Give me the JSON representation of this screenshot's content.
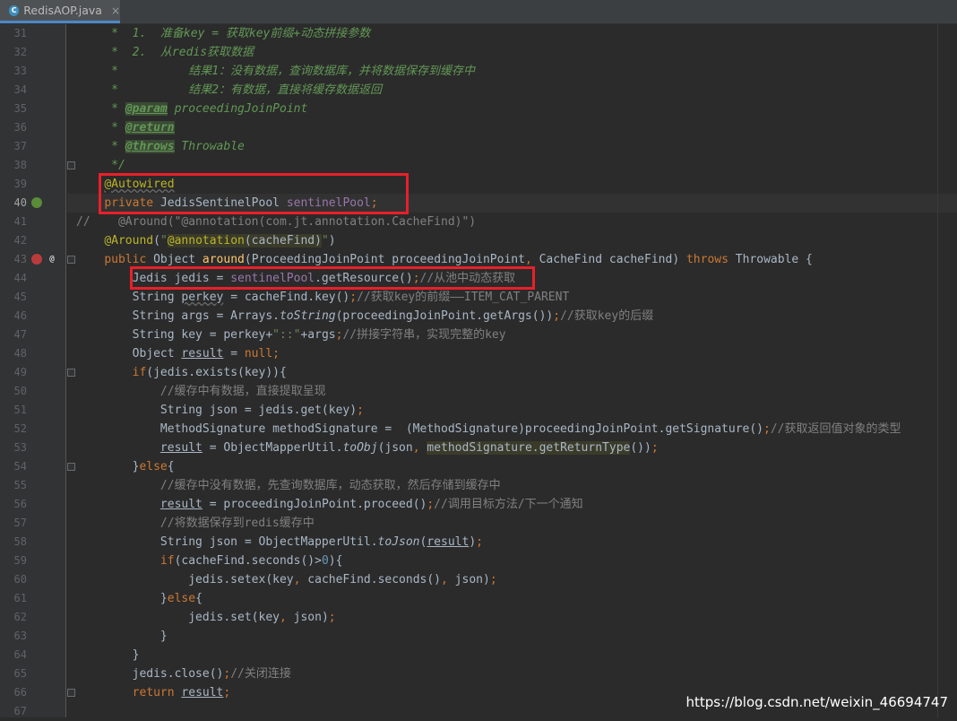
{
  "tab": {
    "filename": "RedisAOP.java",
    "icon": "java-class-icon",
    "close": "×",
    "file_badge": "C"
  },
  "lines": [
    {
      "n": "31",
      "seg": [
        [
          "",
          "    "
        ],
        [
          "cm",
          " *  1.  准备key = 获取key前缀+动态拼接参数"
        ]
      ]
    },
    {
      "n": "32",
      "seg": [
        [
          "",
          "    "
        ],
        [
          "cm",
          " *  2.  从redis获取数据"
        ]
      ]
    },
    {
      "n": "33",
      "seg": [
        [
          "",
          "    "
        ],
        [
          "cm",
          " *          结果1：没有数据，查询数据库，并将数据保存到缓存中"
        ]
      ]
    },
    {
      "n": "34",
      "seg": [
        [
          "",
          "    "
        ],
        [
          "cm",
          " *          结果2：有数据，直接将缓存数据返回"
        ]
      ]
    },
    {
      "n": "35",
      "seg": [
        [
          "",
          "    "
        ],
        [
          "cm",
          " * "
        ],
        [
          "tag",
          "@param"
        ],
        [
          "cm",
          " proceedingJoinPoint"
        ]
      ]
    },
    {
      "n": "36",
      "seg": [
        [
          "",
          "    "
        ],
        [
          "cm",
          " * "
        ],
        [
          "tag",
          "@return"
        ]
      ]
    },
    {
      "n": "37",
      "seg": [
        [
          "",
          "    "
        ],
        [
          "cm",
          " * "
        ],
        [
          "tag",
          "@throws"
        ],
        [
          "cm",
          " Throwable"
        ]
      ]
    },
    {
      "n": "38",
      "seg": [
        [
          "",
          "    "
        ],
        [
          "cm",
          " */"
        ]
      ]
    },
    {
      "n": "39",
      "seg": [
        [
          "",
          "    "
        ],
        [
          "an wv",
          "@Autowired"
        ]
      ]
    },
    {
      "n": "40",
      "seg": [
        [
          "",
          "    "
        ],
        [
          "k",
          "private "
        ],
        [
          "",
          "JedisSentinelPool "
        ],
        [
          "fd",
          "sentinelPool"
        ],
        [
          "k",
          ";"
        ]
      ]
    },
    {
      "n": "41",
      "seg": [
        [
          "lc",
          "//    @Around(\"@annotation(com.jt.annotation.CacheFind)\")"
        ]
      ]
    },
    {
      "n": "42",
      "seg": [
        [
          "",
          "    "
        ],
        [
          "an",
          "@Around"
        ],
        [
          "",
          "("
        ],
        [
          "s",
          "\""
        ],
        [
          "hl an",
          "@annotation"
        ],
        [
          "hl",
          "(cacheFind)"
        ],
        [
          "s",
          "\""
        ],
        [
          "",
          ")"
        ]
      ]
    },
    {
      "n": "43",
      "seg": [
        [
          "",
          "    "
        ],
        [
          "k",
          "public "
        ],
        [
          "",
          "Object "
        ],
        [
          "fn",
          "around"
        ],
        [
          "",
          "(ProceedingJoinPoint proceedingJoinPoint"
        ],
        [
          "k",
          ", "
        ],
        [
          "",
          "CacheFind cacheFind) "
        ],
        [
          "k",
          "throws "
        ],
        [
          "",
          "Throwable {"
        ]
      ]
    },
    {
      "n": "44",
      "seg": [
        [
          "",
          "        Jedis jedis = "
        ],
        [
          "fd",
          "sentinelPool"
        ],
        [
          "",
          ".getResource()"
        ],
        [
          "k",
          ";"
        ],
        [
          "lc",
          "//从池中动态获取"
        ]
      ]
    },
    {
      "n": "45",
      "seg": [
        [
          "",
          "        String "
        ],
        [
          "wv",
          "perkey"
        ],
        [
          "",
          " = cacheFind.key()"
        ],
        [
          "k",
          ";"
        ],
        [
          "lc",
          "//获取key的前缀——ITEM_CAT_PARENT"
        ]
      ]
    },
    {
      "n": "46",
      "seg": [
        [
          "",
          "        String args = Arrays."
        ],
        [
          "it",
          "toString"
        ],
        [
          "",
          "(proceedingJoinPoint.getArgs())"
        ],
        [
          "k",
          ";"
        ],
        [
          "lc",
          "//获取key的后缀"
        ]
      ]
    },
    {
      "n": "47",
      "seg": [
        [
          "",
          "        String key = perkey+"
        ],
        [
          "s",
          "\"::\""
        ],
        [
          "",
          "+args"
        ],
        [
          "k",
          ";"
        ],
        [
          "lc",
          "//拼接字符串，实现完整的key"
        ]
      ]
    },
    {
      "n": "48",
      "seg": [
        [
          "",
          "        Object "
        ],
        [
          "ul",
          "result"
        ],
        [
          "",
          " = "
        ],
        [
          "k",
          "null;"
        ]
      ]
    },
    {
      "n": "49",
      "seg": [
        [
          "",
          "        "
        ],
        [
          "k",
          "if"
        ],
        [
          "",
          "(jedis.exists(key)){"
        ]
      ]
    },
    {
      "n": "50",
      "seg": [
        [
          "",
          "            "
        ],
        [
          "lc",
          "//缓存中有数据，直接提取呈现"
        ]
      ]
    },
    {
      "n": "51",
      "seg": [
        [
          "",
          "            String json = jedis.get(key)"
        ],
        [
          "k",
          ";"
        ]
      ]
    },
    {
      "n": "52",
      "seg": [
        [
          "",
          "            MethodSignature methodSignature =  (MethodSignature)proceedingJoinPoint.getSignature()"
        ],
        [
          "k",
          ";"
        ],
        [
          "lc",
          "//获取返回值对象的类型"
        ]
      ]
    },
    {
      "n": "53",
      "seg": [
        [
          "",
          "            "
        ],
        [
          "ul",
          "result"
        ],
        [
          "",
          " = ObjectMapperUtil."
        ],
        [
          "it",
          "toObj"
        ],
        [
          "",
          "(json"
        ],
        [
          "k",
          ", "
        ],
        [
          "hl",
          "methodSignature.getReturnType"
        ],
        [
          "",
          "())"
        ],
        [
          "k",
          ";"
        ]
      ]
    },
    {
      "n": "54",
      "seg": [
        [
          "",
          "        }"
        ],
        [
          "k",
          "else"
        ],
        [
          "",
          "{"
        ]
      ]
    },
    {
      "n": "55",
      "seg": [
        [
          "",
          "            "
        ],
        [
          "lc",
          "//缓存中没有数据，先查询数据库，动态获取，然后存储到缓存中"
        ]
      ]
    },
    {
      "n": "56",
      "seg": [
        [
          "",
          "            "
        ],
        [
          "ul",
          "result"
        ],
        [
          "",
          " = proceedingJoinPoint.proceed()"
        ],
        [
          "k",
          ";"
        ],
        [
          "lc",
          "//调用目标方法/下一个通知"
        ]
      ]
    },
    {
      "n": "57",
      "seg": [
        [
          "",
          "            "
        ],
        [
          "lc",
          "//将数据保存到redis缓存中"
        ]
      ]
    },
    {
      "n": "58",
      "seg": [
        [
          "",
          "            String json = ObjectMapperUtil."
        ],
        [
          "it",
          "toJson"
        ],
        [
          "",
          "("
        ],
        [
          "ul",
          "result"
        ],
        [
          "",
          ")"
        ],
        [
          "k",
          ";"
        ]
      ]
    },
    {
      "n": "59",
      "seg": [
        [
          "",
          "            "
        ],
        [
          "k",
          "if"
        ],
        [
          "",
          "(cacheFind.seconds()>"
        ],
        [
          "n",
          "0"
        ],
        [
          "",
          "){"
        ]
      ]
    },
    {
      "n": "60",
      "seg": [
        [
          "",
          "                jedis.setex(key"
        ],
        [
          "k",
          ", "
        ],
        [
          "",
          "cacheFind.seconds()"
        ],
        [
          "k",
          ", "
        ],
        [
          "",
          "json)"
        ],
        [
          "k",
          ";"
        ]
      ]
    },
    {
      "n": "61",
      "seg": [
        [
          "",
          "            }"
        ],
        [
          "k",
          "else"
        ],
        [
          "",
          "{"
        ]
      ]
    },
    {
      "n": "62",
      "seg": [
        [
          "",
          "                jedis.set(key"
        ],
        [
          "k",
          ", "
        ],
        [
          "",
          "json)"
        ],
        [
          "k",
          ";"
        ]
      ]
    },
    {
      "n": "63",
      "seg": [
        [
          "",
          "            }"
        ]
      ]
    },
    {
      "n": "64",
      "seg": [
        [
          "",
          "        }"
        ]
      ]
    },
    {
      "n": "65",
      "seg": [
        [
          "",
          "        jedis.close()"
        ],
        [
          "k",
          ";"
        ],
        [
          "lc",
          "//关闭连接"
        ]
      ]
    },
    {
      "n": "66",
      "seg": [
        [
          "",
          "        "
        ],
        [
          "k",
          "return "
        ],
        [
          "ul",
          "result"
        ],
        [
          "k",
          ";"
        ]
      ]
    },
    {
      "n": "67",
      "seg": [
        [
          "",
          ""
        ]
      ]
    }
  ],
  "caret_line": "40",
  "gutter_icons": {
    "line40": "spring-bean-icon",
    "line43a": "aspect-advice-icon",
    "line43b": "override-at-icon"
  },
  "colors": {
    "highlight_box": "#e8202a",
    "background": "#2b2b2b",
    "keyword": "#cc7832"
  },
  "watermark": "https://blog.csdn.net/weixin_46694747"
}
